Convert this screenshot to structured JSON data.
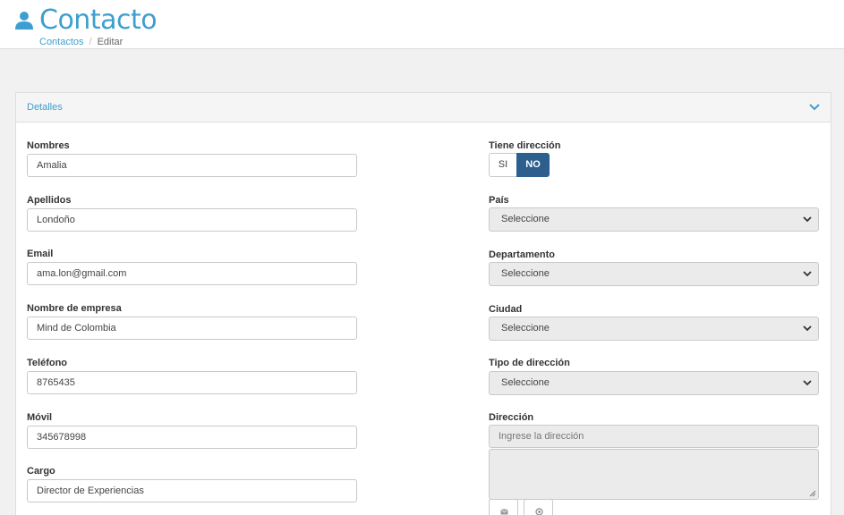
{
  "header": {
    "title": "Contacto"
  },
  "breadcrumb": {
    "items": [
      "Contactos",
      "Editar"
    ],
    "separator": "/"
  },
  "panel": {
    "title": "Detalles"
  },
  "left_fields": [
    {
      "label": "Nombres",
      "value": "Amalia"
    },
    {
      "label": "Apellidos",
      "value": "Londoño"
    },
    {
      "label": "Email",
      "value": "ama.lon@gmail.com"
    },
    {
      "label": "Nombre de empresa",
      "value": "Mind de Colombia"
    },
    {
      "label": "Teléfono",
      "value": "8765435"
    },
    {
      "label": "Móvil",
      "value": "345678998"
    },
    {
      "label": "Cargo",
      "value": "Director de Experiencias"
    }
  ],
  "right": {
    "has_address_label": "Tiene dirección",
    "toggle": {
      "yes": "SI",
      "no": "NO",
      "selected": "NO"
    },
    "country_label": "País",
    "country_value": "Seleccione",
    "department_label": "Departamento",
    "department_value": "Seleccione",
    "city_label": "Ciudad",
    "city_value": "Seleccione",
    "address_type_label": "Tipo de dirección",
    "address_type_value": "Seleccione",
    "address_label": "Dirección",
    "address_placeholder": "Ingrese la dirección"
  },
  "colors": {
    "accent": "#3d9fd0",
    "toggle_active": "#2c5f8e"
  },
  "icons": [
    "user-icon",
    "chevron-down-icon",
    "envelope-icon",
    "location-icon"
  ]
}
